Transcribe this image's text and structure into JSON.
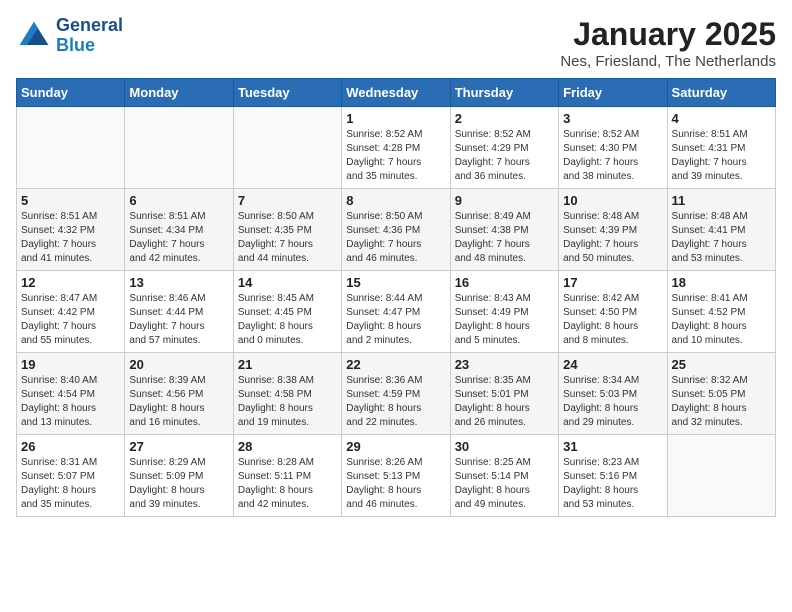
{
  "header": {
    "logo_line1": "General",
    "logo_line2": "Blue",
    "title": "January 2025",
    "subtitle": "Nes, Friesland, The Netherlands"
  },
  "weekdays": [
    "Sunday",
    "Monday",
    "Tuesday",
    "Wednesday",
    "Thursday",
    "Friday",
    "Saturday"
  ],
  "weeks": [
    [
      {
        "day": "",
        "info": ""
      },
      {
        "day": "",
        "info": ""
      },
      {
        "day": "",
        "info": ""
      },
      {
        "day": "1",
        "info": "Sunrise: 8:52 AM\nSunset: 4:28 PM\nDaylight: 7 hours\nand 35 minutes."
      },
      {
        "day": "2",
        "info": "Sunrise: 8:52 AM\nSunset: 4:29 PM\nDaylight: 7 hours\nand 36 minutes."
      },
      {
        "day": "3",
        "info": "Sunrise: 8:52 AM\nSunset: 4:30 PM\nDaylight: 7 hours\nand 38 minutes."
      },
      {
        "day": "4",
        "info": "Sunrise: 8:51 AM\nSunset: 4:31 PM\nDaylight: 7 hours\nand 39 minutes."
      }
    ],
    [
      {
        "day": "5",
        "info": "Sunrise: 8:51 AM\nSunset: 4:32 PM\nDaylight: 7 hours\nand 41 minutes."
      },
      {
        "day": "6",
        "info": "Sunrise: 8:51 AM\nSunset: 4:34 PM\nDaylight: 7 hours\nand 42 minutes."
      },
      {
        "day": "7",
        "info": "Sunrise: 8:50 AM\nSunset: 4:35 PM\nDaylight: 7 hours\nand 44 minutes."
      },
      {
        "day": "8",
        "info": "Sunrise: 8:50 AM\nSunset: 4:36 PM\nDaylight: 7 hours\nand 46 minutes."
      },
      {
        "day": "9",
        "info": "Sunrise: 8:49 AM\nSunset: 4:38 PM\nDaylight: 7 hours\nand 48 minutes."
      },
      {
        "day": "10",
        "info": "Sunrise: 8:48 AM\nSunset: 4:39 PM\nDaylight: 7 hours\nand 50 minutes."
      },
      {
        "day": "11",
        "info": "Sunrise: 8:48 AM\nSunset: 4:41 PM\nDaylight: 7 hours\nand 53 minutes."
      }
    ],
    [
      {
        "day": "12",
        "info": "Sunrise: 8:47 AM\nSunset: 4:42 PM\nDaylight: 7 hours\nand 55 minutes."
      },
      {
        "day": "13",
        "info": "Sunrise: 8:46 AM\nSunset: 4:44 PM\nDaylight: 7 hours\nand 57 minutes."
      },
      {
        "day": "14",
        "info": "Sunrise: 8:45 AM\nSunset: 4:45 PM\nDaylight: 8 hours\nand 0 minutes."
      },
      {
        "day": "15",
        "info": "Sunrise: 8:44 AM\nSunset: 4:47 PM\nDaylight: 8 hours\nand 2 minutes."
      },
      {
        "day": "16",
        "info": "Sunrise: 8:43 AM\nSunset: 4:49 PM\nDaylight: 8 hours\nand 5 minutes."
      },
      {
        "day": "17",
        "info": "Sunrise: 8:42 AM\nSunset: 4:50 PM\nDaylight: 8 hours\nand 8 minutes."
      },
      {
        "day": "18",
        "info": "Sunrise: 8:41 AM\nSunset: 4:52 PM\nDaylight: 8 hours\nand 10 minutes."
      }
    ],
    [
      {
        "day": "19",
        "info": "Sunrise: 8:40 AM\nSunset: 4:54 PM\nDaylight: 8 hours\nand 13 minutes."
      },
      {
        "day": "20",
        "info": "Sunrise: 8:39 AM\nSunset: 4:56 PM\nDaylight: 8 hours\nand 16 minutes."
      },
      {
        "day": "21",
        "info": "Sunrise: 8:38 AM\nSunset: 4:58 PM\nDaylight: 8 hours\nand 19 minutes."
      },
      {
        "day": "22",
        "info": "Sunrise: 8:36 AM\nSunset: 4:59 PM\nDaylight: 8 hours\nand 22 minutes."
      },
      {
        "day": "23",
        "info": "Sunrise: 8:35 AM\nSunset: 5:01 PM\nDaylight: 8 hours\nand 26 minutes."
      },
      {
        "day": "24",
        "info": "Sunrise: 8:34 AM\nSunset: 5:03 PM\nDaylight: 8 hours\nand 29 minutes."
      },
      {
        "day": "25",
        "info": "Sunrise: 8:32 AM\nSunset: 5:05 PM\nDaylight: 8 hours\nand 32 minutes."
      }
    ],
    [
      {
        "day": "26",
        "info": "Sunrise: 8:31 AM\nSunset: 5:07 PM\nDaylight: 8 hours\nand 35 minutes."
      },
      {
        "day": "27",
        "info": "Sunrise: 8:29 AM\nSunset: 5:09 PM\nDaylight: 8 hours\nand 39 minutes."
      },
      {
        "day": "28",
        "info": "Sunrise: 8:28 AM\nSunset: 5:11 PM\nDaylight: 8 hours\nand 42 minutes."
      },
      {
        "day": "29",
        "info": "Sunrise: 8:26 AM\nSunset: 5:13 PM\nDaylight: 8 hours\nand 46 minutes."
      },
      {
        "day": "30",
        "info": "Sunrise: 8:25 AM\nSunset: 5:14 PM\nDaylight: 8 hours\nand 49 minutes."
      },
      {
        "day": "31",
        "info": "Sunrise: 8:23 AM\nSunset: 5:16 PM\nDaylight: 8 hours\nand 53 minutes."
      },
      {
        "day": "",
        "info": ""
      }
    ]
  ]
}
